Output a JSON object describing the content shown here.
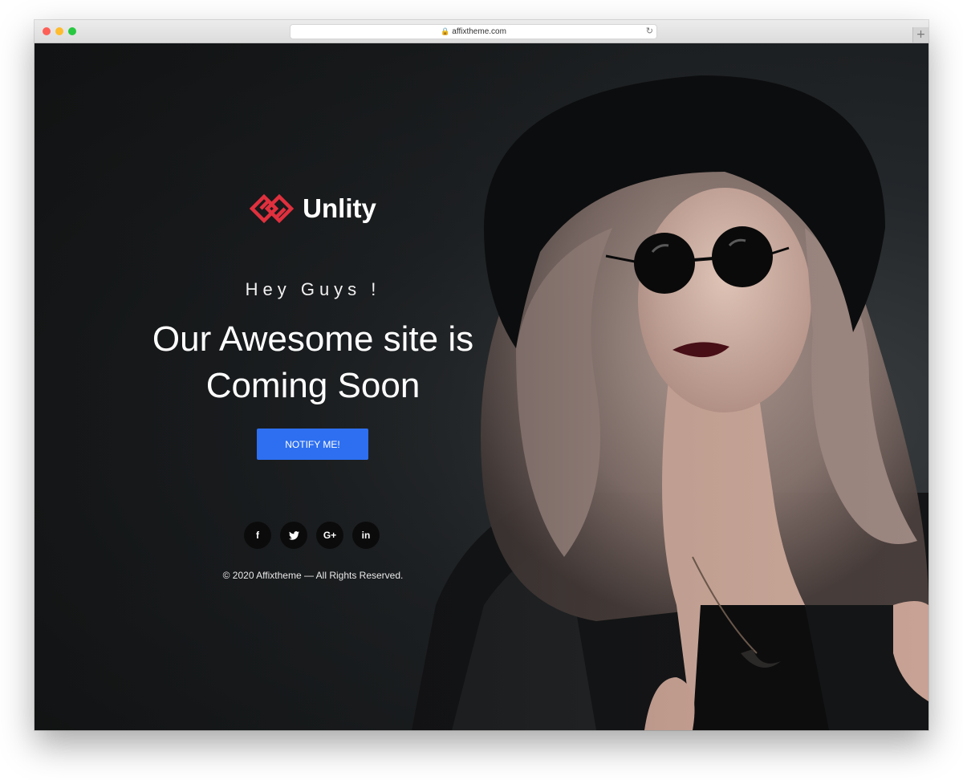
{
  "browser": {
    "url": "affixtheme.com",
    "lock_icon": "lock-icon",
    "reload_icon": "reload-icon",
    "new_tab_icon": "plus-icon"
  },
  "brand": {
    "name": "Unlity",
    "logo_icon": "interlocked-diamond-logo",
    "logo_color": "#e0303e"
  },
  "hero": {
    "greeting": "Hey Guys !",
    "headline_line1": "Our Awesome site is",
    "headline_line2": "Coming Soon",
    "notify_label": "NOTIFY ME!",
    "notify_color": "#2d6ff0"
  },
  "social": [
    {
      "icon": "facebook-icon",
      "glyph": "f"
    },
    {
      "icon": "twitter-icon",
      "glyph": "🐦"
    },
    {
      "icon": "google-plus-icon",
      "glyph": "G+"
    },
    {
      "icon": "linkedin-icon",
      "glyph": "in"
    }
  ],
  "footer": {
    "copyright": "© 2020 Affixtheme — All Rights Reserved."
  }
}
